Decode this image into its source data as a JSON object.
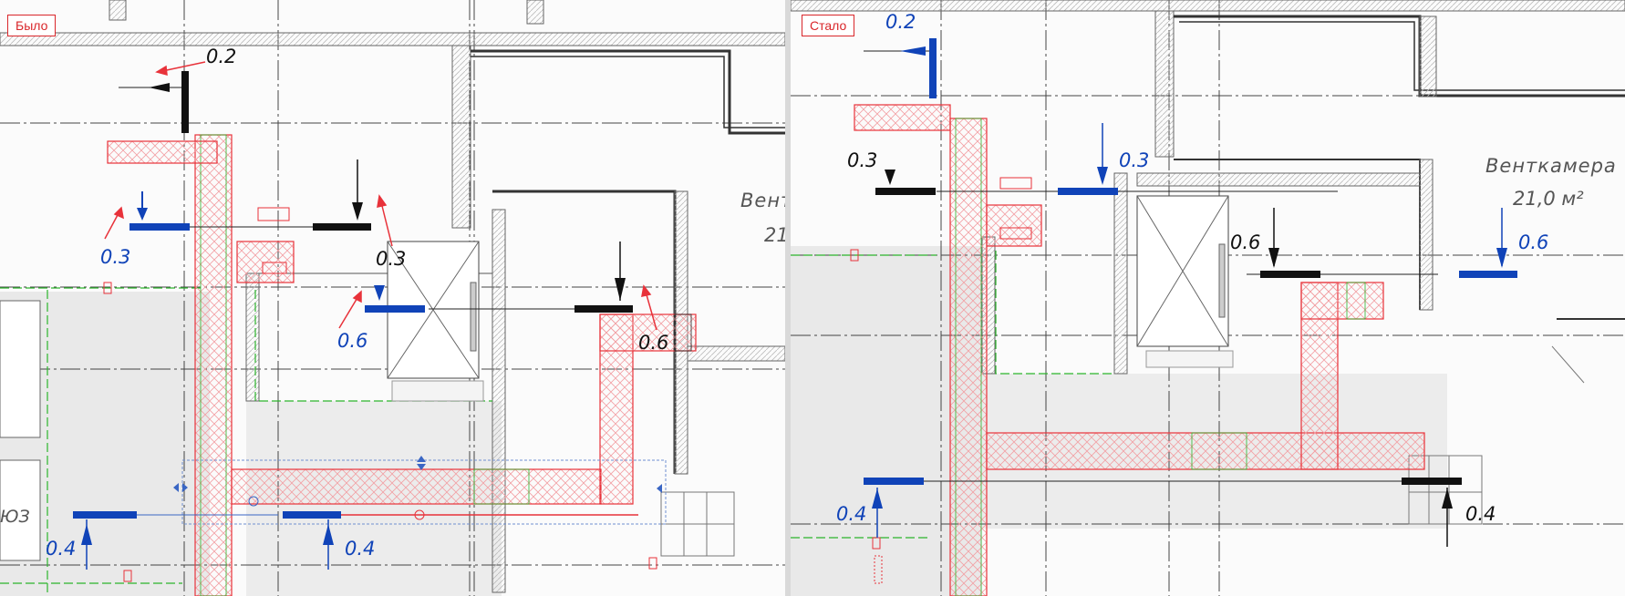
{
  "before": {
    "tag": "Было",
    "room_name": "Вент",
    "room_area": "21,",
    "room_partial": "ЮЗ",
    "terminals": {
      "t1": {
        "label": "0.2"
      },
      "t2": {
        "label": "0.3"
      },
      "t3": {
        "label": "0.3"
      },
      "t4": {
        "label": "0.6"
      },
      "t5": {
        "label": "0.6"
      },
      "t6": {
        "label": "0.4"
      },
      "t7": {
        "label": "0.4"
      }
    }
  },
  "after": {
    "tag": "Стало",
    "room_name": "Венткамера",
    "room_area": "21,0 м²",
    "terminals": {
      "t1": {
        "label": "0.2"
      },
      "t2": {
        "label": "0.3"
      },
      "t3": {
        "label": "0.3"
      },
      "t4": {
        "label": "0.6"
      },
      "t5": {
        "label": "0.6"
      },
      "t6": {
        "label": "0.4"
      },
      "t7": {
        "label": "0.4"
      }
    }
  },
  "colors": {
    "duct": "#e8323a",
    "hatch": "#f2a0a4",
    "blue_terminal": "#1043b8",
    "black_terminal": "#111111",
    "wall": "#555555",
    "green_line": "#2cb52c",
    "grey_fill": "#e9e9e9"
  }
}
